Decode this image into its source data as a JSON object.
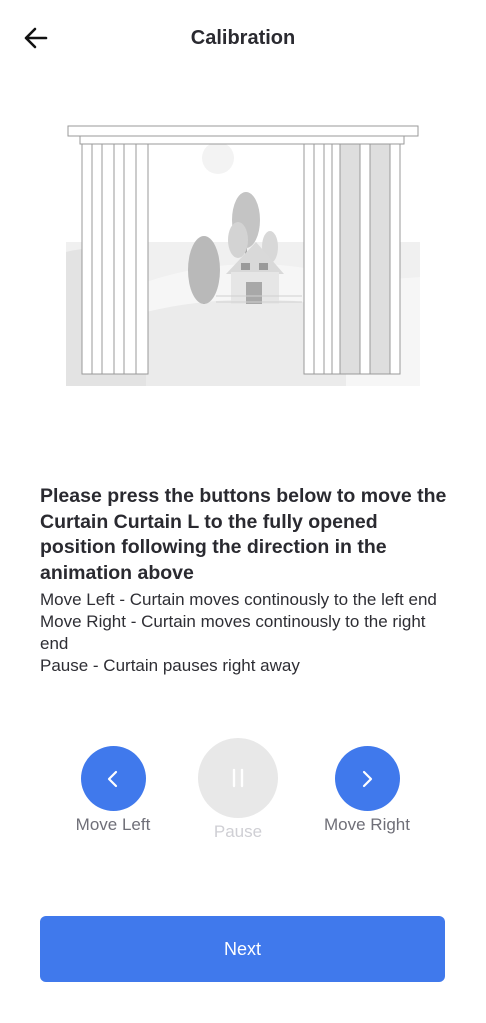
{
  "header": {
    "title": "Calibration",
    "back_icon": "arrow-left-icon"
  },
  "illustration": {
    "description_icon": "curtain-window-scene-icon"
  },
  "instructions": {
    "headline": "Please press the buttons below to move the Curtain Curtain L to the fully opened position following the direction in the animation above",
    "lines": [
      "Move Left - Curtain moves continously to the left end",
      "Move Right - Curtain moves continously to the right end",
      "Pause - Curtain pauses right away"
    ]
  },
  "controls": {
    "move_left": {
      "label": "Move Left",
      "icon": "chevron-left-icon",
      "enabled": true
    },
    "pause": {
      "label": "Pause",
      "icon": "pause-icon",
      "enabled": false
    },
    "move_right": {
      "label": "Move Right",
      "icon": "chevron-right-icon",
      "enabled": true
    }
  },
  "footer": {
    "next_label": "Next"
  },
  "colors": {
    "accent": "#4079ec",
    "disabled_bg": "#e8e8e8",
    "disabled_text": "#cfcfd4",
    "label_text": "#6f6f78"
  }
}
